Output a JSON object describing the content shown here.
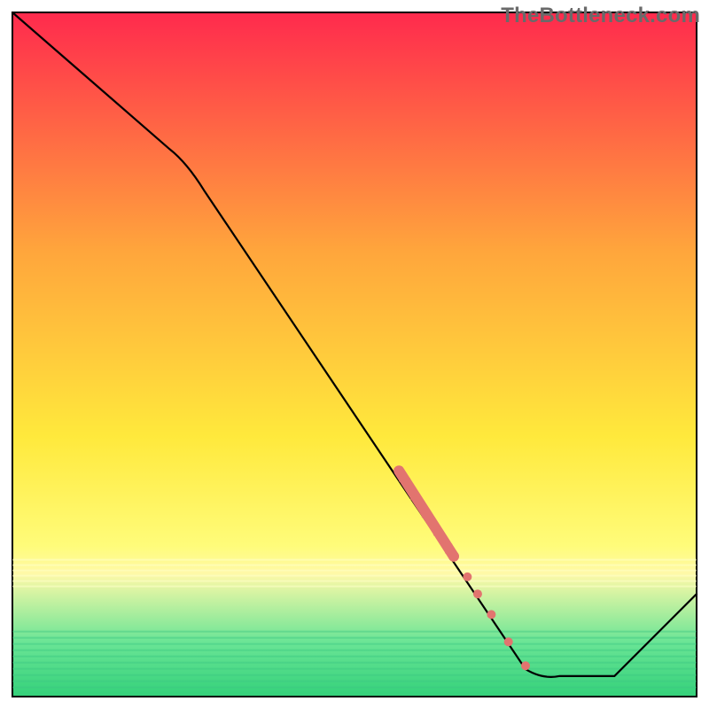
{
  "watermark": {
    "text": "TheBottleneck.com"
  },
  "chart_data": {
    "type": "line",
    "title": "",
    "xlabel": "",
    "ylabel": "",
    "xlim": [
      0,
      100
    ],
    "ylim": [
      0,
      100
    ],
    "grid": false,
    "legend": false,
    "background_gradient": {
      "top": "#ff2a4d",
      "upper_mid": "#ffa63c",
      "mid": "#ffe93c",
      "light_band": "#fff9a8",
      "green_top": "#6be596",
      "green_bottom": "#34d17a"
    },
    "series": [
      {
        "name": "bottleneck-curve",
        "color": "#000000",
        "points": [
          {
            "x": 0,
            "y": 100
          },
          {
            "x": 23,
            "y": 80
          },
          {
            "x": 28,
            "y": 74
          },
          {
            "x": 75,
            "y": 4
          },
          {
            "x": 80,
            "y": 3
          },
          {
            "x": 88,
            "y": 3
          },
          {
            "x": 100,
            "y": 15
          }
        ]
      }
    ],
    "highlight_segment": {
      "name": "highlight-range",
      "color": "#e2746f",
      "thick": {
        "from_index": 0,
        "to_index": 1,
        "width": 12
      },
      "points": [
        {
          "x": 56.5,
          "y": 33.0
        },
        {
          "x": 64.5,
          "y": 20.5
        },
        {
          "x": 66.5,
          "y": 17.5
        },
        {
          "x": 68.0,
          "y": 15.0
        },
        {
          "x": 70.0,
          "y": 12.0
        },
        {
          "x": 72.5,
          "y": 8.0
        },
        {
          "x": 75.0,
          "y": 4.5
        }
      ]
    }
  }
}
